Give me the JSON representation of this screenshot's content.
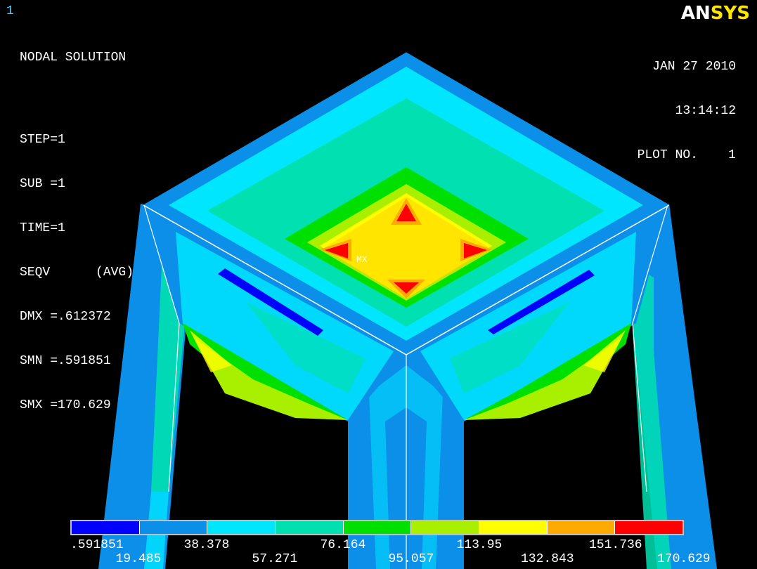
{
  "window_number": "1",
  "logo": {
    "an": "AN",
    "sys": "SYS"
  },
  "info": {
    "title": "NODAL SOLUTION",
    "lines": [
      "STEP=1",
      "SUB =1",
      "TIME=1",
      "SEQV      (AVG)",
      "DMX =.612372",
      "SMN =.591851",
      "SMX =170.629"
    ]
  },
  "date": {
    "date": "JAN 27 2010",
    "time": "13:14:12",
    "plot": "PLOT NO.    1"
  },
  "max_marker": "MX",
  "legend": {
    "colors": [
      "#0000ff",
      "#0b8fe8",
      "#00e6ff",
      "#00e0b0",
      "#00e000",
      "#a8f000",
      "#ffff00",
      "#ffaa00",
      "#ff0000"
    ],
    "tick_labels": [
      ".591851",
      "19.485",
      "38.378",
      "57.271",
      "76.164",
      "95.057",
      "113.95",
      "132.843",
      "151.736",
      "170.629"
    ]
  },
  "palette": {
    "background": "#000000",
    "edge": "#ffffff",
    "c1": "#0000ff",
    "c2": "#0b8fe8",
    "c3": "#00e6ff",
    "c4": "#00e0b0",
    "c5": "#00e000",
    "c6": "#a8f000",
    "c7": "#ffff00",
    "c8": "#ffaa00",
    "c9": "#ff0000"
  }
}
